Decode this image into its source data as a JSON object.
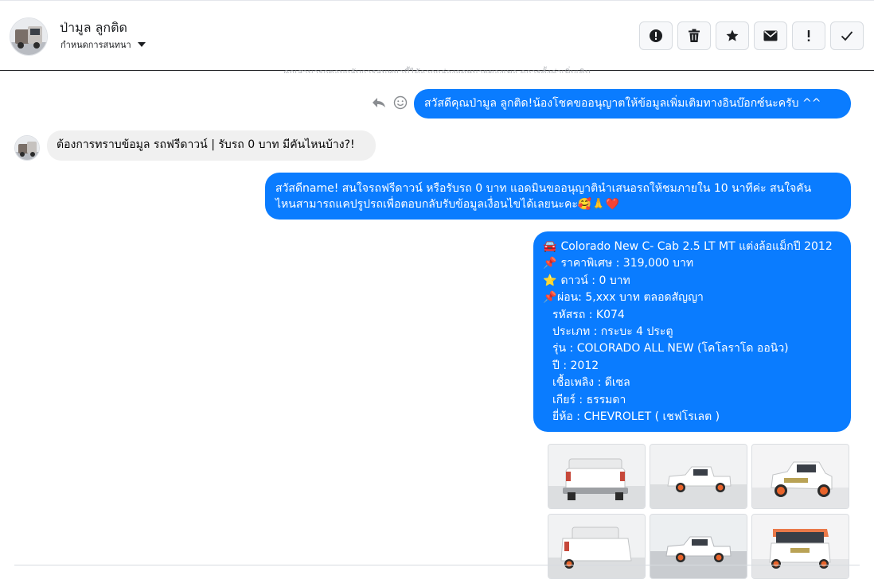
{
  "header": {
    "contact_name": "ป่ามูล ลูกติด",
    "assign_label": "กำหนดการสนทนา",
    "faded_text": "คุณสามารถตอบกลับการสนทนานี้ได้จากกล่องจดหมายของเพจ ดูการตั้งค่าเพิ่มเติม"
  },
  "toolbar": {
    "icons": [
      "alert-circle-icon",
      "trash-icon",
      "star-icon",
      "envelope-icon",
      "exclamation-icon",
      "check-icon"
    ],
    "icon_colors": {
      "default": "#1c1e21"
    }
  },
  "messages": {
    "greeting": "สวัสดีคุณป่ามูล ลูกติด!น้องโชคขออนุญาตให้ข้อมูลเพิ่มเติมทางอินบ๊อกซ์นะครับ ^^",
    "incoming": "ต้องการทราบข้อมูล รถฟรีดาวน์ | รับรถ 0 บาท มีคันไหนบ้าง?!",
    "offer_line1": "สวัสดีname! สนใจรถฟรีดาวน์ หรือรับรถ 0 บาท แอดมินขออนุญาตินำเสนอรถให้ชมภายใน 10 นาทีค่ะ สนใจคัน",
    "offer_line2": "ไหนสามารถแคปรูปรถเพื่อตอบกลับรับข้อมูลเงื่อนไขได้เลยนะคะ🥰🙏❤️"
  },
  "car_card": {
    "lines": [
      {
        "icon": "🚘",
        "text": "Colorado New C- Cab 2.5 LT MT แต่งล้อแม็กปี 2012"
      },
      {
        "icon": "📌",
        "text": "ราคาพิเศษ : 319,000 บาท"
      },
      {
        "icon": "⭐",
        "text": "ดาวน์ : 0 บาท"
      },
      {
        "icon": "📌",
        "text": "ผ่อน: 5,xxx บาท ตลอดสัญญา"
      },
      {
        "icon": "",
        "text": "รหัสรถ : K074"
      },
      {
        "icon": "",
        "text": "ประเภท : กระบะ 4 ประตู"
      },
      {
        "icon": "",
        "text": "รุ่น : COLORADO ALL NEW (โคโลราโด ออนิว)"
      },
      {
        "icon": "",
        "text": "ปี : 2012"
      },
      {
        "icon": "",
        "text": "เชื้อเพลิง : ดีเซล"
      },
      {
        "icon": "",
        "text": "เกียร์ : ธรรมดา"
      },
      {
        "icon": "",
        "text": "ยี่ห้อ : CHEVROLET ( เชฟโรเลต )"
      }
    ]
  },
  "colors": {
    "outgoing_bubble": "#0a7cff",
    "incoming_bubble": "#f0f0f0",
    "car_body": "#ffffff",
    "wheel_accent": "#e8632a"
  }
}
